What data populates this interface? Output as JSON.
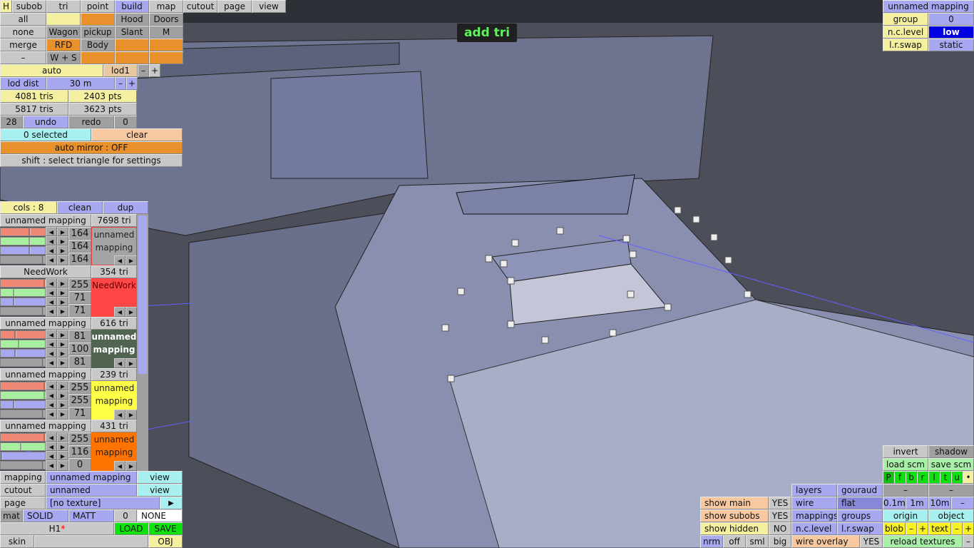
{
  "colors": {
    "button": "#c8c8c8",
    "active_tab": "#a8a8f0",
    "yellow": "#f4f0a0",
    "orange": "#e8902c",
    "peach": "#f8c8a0",
    "cyan": "#a8f0f0",
    "green": "#10e010",
    "light_green": "#a8f0a8",
    "low_highlight": "#0000e0"
  },
  "tabs": {
    "h": "H",
    "items": [
      "subob",
      "tri",
      "point",
      "build",
      "map",
      "cutout",
      "page",
      "view"
    ],
    "active": "build"
  },
  "presets": {
    "all": "all",
    "none": "none",
    "merge": "merge",
    "dash": "–",
    "hood": "Hood",
    "doors": "Doors",
    "wagon": "Wagon",
    "pickup": "pickup",
    "slant": "Slant",
    "m": "M",
    "rfd": "RFD",
    "body": "Body",
    "ws": "W + S"
  },
  "lod": {
    "auto": "auto",
    "lod": "lod1",
    "minus": "–",
    "plus": "+",
    "dist_label": "lod dist",
    "dist_value": "30 m"
  },
  "stats": {
    "tris1": "4081 tris",
    "pts1": "2403 pts",
    "tris2": "5817 tris",
    "pts2": "3623 pts"
  },
  "undo": {
    "count": "28",
    "undo": "undo",
    "redo": "redo",
    "redo_count": "0"
  },
  "selection": {
    "selected": "0 selected",
    "clear": "clear",
    "mirror": "auto mirror : OFF",
    "hint": "shift : select triangle for settings"
  },
  "mode_label": "add tri",
  "mappings_header": {
    "cols": "cols : 8",
    "clean": "clean",
    "dup": "dup"
  },
  "mappings": [
    {
      "name": "unnamed mapping",
      "tris": "7698 tri",
      "r": 164,
      "g": 164,
      "b": 164,
      "label": "unnamed mapping",
      "swatch": "#a4a4a4",
      "text_color": "#222"
    },
    {
      "name": "NeedWork",
      "tris": "354 tri",
      "r": 255,
      "g": 71,
      "b": 71,
      "label": "NeedWork",
      "swatch": "#ff4747",
      "text_color": "#600"
    },
    {
      "name": "unnamed mapping",
      "tris": "616 tri",
      "r": 81,
      "g": 100,
      "b": 81,
      "label": "unnamed mapping",
      "swatch": "#516451",
      "text_color": "#fff"
    },
    {
      "name": "unnamed mapping",
      "tris": "239 tri",
      "r": 255,
      "g": 255,
      "b": 71,
      "label": "unnamed mapping",
      "swatch": "#ffff47",
      "text_color": "#222"
    },
    {
      "name": "unnamed mapping",
      "tris": "431 tri",
      "r": 255,
      "g": 116,
      "b": 0,
      "label": "unnamed mapping",
      "swatch": "#ff7400",
      "text_color": "#222"
    }
  ],
  "bottom_left": {
    "mapping_label": "mapping",
    "mapping_value": "unnamed mapping",
    "view": "view",
    "cutout_label": "cutout",
    "cutout_value": "unnamed",
    "page_label": "page",
    "page_value": "[no texture]",
    "play": "▶",
    "mat": "mat",
    "solid": "SOLID",
    "matt": "MATT",
    "mat_num": "0",
    "none": "NONE",
    "file": "H1",
    "modified": "*",
    "load": "LOAD",
    "save": "SAVE",
    "skin": "skin",
    "obj": "OBJ"
  },
  "top_right": {
    "mapping": "unnamed mapping",
    "group_label": "group",
    "group_value": "0",
    "nc_label": "n.c.level",
    "nc_value": "low",
    "lr_label": "l.r.swap",
    "lr_value": "static"
  },
  "bottom_right": {
    "invert": "invert",
    "shadow": "shadow",
    "load_scm": "load scm",
    "save_scm": "save scm",
    "views": [
      "P",
      "f",
      "b",
      "r",
      "l",
      "t",
      "u",
      "•"
    ],
    "dash": "–",
    "grid": [
      "0.1m",
      "1m",
      "10m",
      "–"
    ],
    "origin": "origin",
    "object": "object",
    "blob": "blob",
    "text": "text",
    "minus": "–",
    "plus": "+",
    "reload": "reload textures",
    "layers": "layers",
    "gouraud": "gouraud",
    "wire": "wire",
    "flat": "flat",
    "mappings": "mappings",
    "groups": "groups",
    "nc_level": "n.c.level",
    "lr_swap": "l.r.swap",
    "show_main": "show main",
    "show_subobs": "show subobs",
    "show_hidden": "show hidden",
    "yes": "YES",
    "no": "NO",
    "nrm": "nrm",
    "off": "off",
    "sml": "sml",
    "big": "big",
    "wire_overlay": "wire overlay"
  }
}
